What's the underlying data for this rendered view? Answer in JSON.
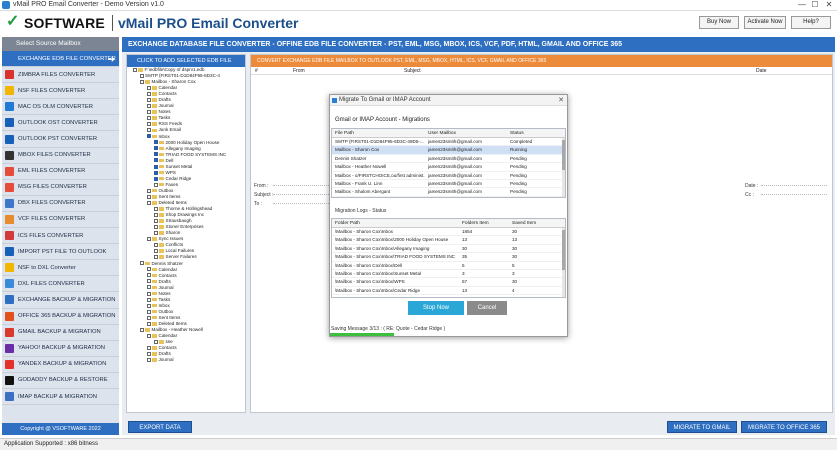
{
  "window": {
    "title": "vMail PRO Email Converter - Demo Version v1.0",
    "min": "—",
    "max": "☐",
    "close": "✕"
  },
  "header": {
    "brand": "SOFTWARE",
    "product": "vMail PRO Email Converter",
    "buy_now": "Buy Now",
    "activate_now": "Activate Now",
    "help": "Help?"
  },
  "sidebar": {
    "header": "Select Source Mailbox",
    "items": [
      {
        "label": "EXCHANGE EDB FILE CONVERTER",
        "active": true,
        "color": "#2e6fc1"
      },
      {
        "label": "ZIMBRA FILES CONVERTER",
        "active": false,
        "color": "#d9342b"
      },
      {
        "label": "NSF FILES CONVERTER",
        "active": false,
        "color": "#f2b500"
      },
      {
        "label": "MAC OS OLM CONVERTER",
        "active": false,
        "color": "#1f7bd6"
      },
      {
        "label": "OUTLOOK OST CONVERTER",
        "active": false,
        "color": "#1760b8"
      },
      {
        "label": "OUTLOOK PST CONVERTER",
        "active": false,
        "color": "#1760b8"
      },
      {
        "label": "MBOX FILES CONVERTER",
        "active": false,
        "color": "#333333"
      },
      {
        "label": "EML FILES CONVERTER",
        "active": false,
        "color": "#e44d3a"
      },
      {
        "label": "MSG FILES CONVERTER",
        "active": false,
        "color": "#e44d3a"
      },
      {
        "label": "DBX FILES CONVERTER",
        "active": false,
        "color": "#3c77c9"
      },
      {
        "label": "VCF FILES CONVERTER",
        "active": false,
        "color": "#e88b2e"
      },
      {
        "label": "ICS FILES CONVERTER",
        "active": false,
        "color": "#d23b3b"
      },
      {
        "label": "IMPORT PST FILE TO OUTLOOK",
        "active": false,
        "color": "#1760b8"
      },
      {
        "label": "NSF to DXL Converter",
        "active": false,
        "color": "#f2b500"
      },
      {
        "label": "DXL FILES CONVERTER",
        "active": false,
        "color": "#3b8bd8"
      },
      {
        "label": "EXCHANGE BACKUP & MIGRATION",
        "active": false,
        "color": "#2e6fc1"
      },
      {
        "label": "OFFICE 365 BACKUP & MIGRATION",
        "active": false,
        "color": "#e3501f"
      },
      {
        "label": "GMAIL BACKUP & MIGRATION",
        "active": false,
        "color": "#d93a2b"
      },
      {
        "label": "YAHOO! BACKUP & MIGRATION",
        "active": false,
        "color": "#6b2ca8"
      },
      {
        "label": "YANDEX BACKUP & MIGRATION",
        "active": false,
        "color": "#e4312b"
      },
      {
        "label": "GODADDY BACKUP & RESTORE",
        "active": false,
        "color": "#111111"
      },
      {
        "label": "IMAP BACKUP & MIGRATION",
        "active": false,
        "color": "#3a6fc4"
      }
    ],
    "copyright": "Copyright @ VSOFTWARE 2022"
  },
  "main": {
    "title": "EXCHANGE DATABASE FILE CONVERTER - OFFINE EDB FILE CONVERTER - PST, EML, MSG, MBOX, ICS, VCF, PDF, HTML, GMAIL AND OFFICE 365",
    "add_button": "CLICK TO ADD SELECTED EDB FILE",
    "orange_bar": "CONVERT EXCHANGE EDB FILE MAILBOX TO OUTLOOK PST, EML, MSG, MBOX, HTML, ICS, VCF, GMAIL AND OFFICE 365",
    "columns": [
      "#",
      "From",
      "Subject",
      "Date"
    ],
    "preview": {
      "from": "From :",
      "subject": "Subject :",
      "to": "To :",
      "date": "Date :",
      "cc": "Cc :"
    },
    "export_data": "EXPORT DATA",
    "migrate_gmail": "MIGRATE TO GMAIL",
    "migrate_office": "MIGRATE TO OFFICE 365"
  },
  "tree": [
    {
      "indent": 0,
      "label": "F:\\edbfile\\Copy of dsprv1.edb",
      "cb": false,
      "folder": true
    },
    {
      "indent": 1,
      "label": "SMTP (FIRST01-D1D84F95-6D3C-4",
      "cb": false,
      "folder": false
    },
    {
      "indent": 1,
      "label": "Mailbox - Sharon Cox",
      "cb": false,
      "folder": true
    },
    {
      "indent": 2,
      "label": "Calendar",
      "cb": false,
      "folder": true
    },
    {
      "indent": 2,
      "label": "Contacts",
      "cb": false,
      "folder": true
    },
    {
      "indent": 2,
      "label": "Drafts",
      "cb": false,
      "folder": true
    },
    {
      "indent": 2,
      "label": "Journal",
      "cb": false,
      "folder": true
    },
    {
      "indent": 2,
      "label": "Notes",
      "cb": false,
      "folder": true
    },
    {
      "indent": 2,
      "label": "Tasks",
      "cb": false,
      "folder": true
    },
    {
      "indent": 2,
      "label": "RSS Feeds",
      "cb": false,
      "folder": true
    },
    {
      "indent": 2,
      "label": "Junk Email",
      "cb": false,
      "folder": true
    },
    {
      "indent": 2,
      "label": "Inbox",
      "cb": true,
      "folder": true
    },
    {
      "indent": 3,
      "label": "2000 Holiday Open House",
      "cb": true,
      "folder": true
    },
    {
      "indent": 3,
      "label": "Allegany Imaging",
      "cb": true,
      "folder": true
    },
    {
      "indent": 3,
      "label": "TRIAD FOOD SYSTEMS INC",
      "cb": true,
      "folder": true
    },
    {
      "indent": 3,
      "label": "Dell",
      "cb": true,
      "folder": true
    },
    {
      "indent": 3,
      "label": "Sunset Metal",
      "cb": true,
      "folder": true
    },
    {
      "indent": 3,
      "label": "WPS",
      "cb": true,
      "folder": true
    },
    {
      "indent": 3,
      "label": "Cedar Ridge",
      "cb": true,
      "folder": true
    },
    {
      "indent": 3,
      "label": "Faxes",
      "cb": false,
      "folder": true
    },
    {
      "indent": 2,
      "label": "Outbox",
      "cb": false,
      "folder": true
    },
    {
      "indent": 2,
      "label": "Sent Items",
      "cb": false,
      "folder": true
    },
    {
      "indent": 2,
      "label": "Deleted Items",
      "cb": false,
      "folder": true
    },
    {
      "indent": 3,
      "label": "Thorne & Hollingshead",
      "cb": false,
      "folder": true
    },
    {
      "indent": 3,
      "label": "Shop Drawings Inc",
      "cb": false,
      "folder": true
    },
    {
      "indent": 3,
      "label": "Strausbaugh",
      "cb": false,
      "folder": true
    },
    {
      "indent": 3,
      "label": "Stoner Enterprises",
      "cb": false,
      "folder": true
    },
    {
      "indent": 3,
      "label": "Sharon",
      "cb": false,
      "folder": true
    },
    {
      "indent": 2,
      "label": "Sync Issues",
      "cb": false,
      "folder": true
    },
    {
      "indent": 3,
      "label": "Conflicts",
      "cb": false,
      "folder": true
    },
    {
      "indent": 3,
      "label": "Local Failures",
      "cb": false,
      "folder": true
    },
    {
      "indent": 3,
      "label": "Server Failures",
      "cb": false,
      "folder": true
    },
    {
      "indent": 1,
      "label": "Dennis Shatzer",
      "cb": false,
      "folder": true
    },
    {
      "indent": 2,
      "label": "Calendar",
      "cb": false,
      "folder": true
    },
    {
      "indent": 2,
      "label": "Contacts",
      "cb": false,
      "folder": true
    },
    {
      "indent": 2,
      "label": "Drafts",
      "cb": false,
      "folder": true
    },
    {
      "indent": 2,
      "label": "Journal",
      "cb": false,
      "folder": true
    },
    {
      "indent": 2,
      "label": "Notes",
      "cb": false,
      "folder": true
    },
    {
      "indent": 2,
      "label": "Tasks",
      "cb": false,
      "folder": true
    },
    {
      "indent": 2,
      "label": "Inbox",
      "cb": false,
      "folder": true
    },
    {
      "indent": 2,
      "label": "Outbox",
      "cb": false,
      "folder": true
    },
    {
      "indent": 2,
      "label": "Sent Items",
      "cb": false,
      "folder": true
    },
    {
      "indent": 2,
      "label": "Deleted Items",
      "cb": false,
      "folder": true
    },
    {
      "indent": 1,
      "label": "Mailbox - Heather Nowell",
      "cb": false,
      "folder": true
    },
    {
      "indent": 2,
      "label": "Calendar",
      "cb": false,
      "folder": true
    },
    {
      "indent": 3,
      "label": "sse",
      "cb": false,
      "folder": true
    },
    {
      "indent": 2,
      "label": "Contacts",
      "cb": false,
      "folder": true
    },
    {
      "indent": 2,
      "label": "Drafts",
      "cb": false,
      "folder": true
    },
    {
      "indent": 2,
      "label": "Journal",
      "cb": false,
      "folder": true
    }
  ],
  "dialog": {
    "title": "Migrate To Gmail or IMAP Account",
    "close": "✕",
    "heading": "Gmail or IMAP Account - Migrations",
    "mig_columns": [
      "File Path",
      "User Mailbox",
      "Status"
    ],
    "migrations": [
      [
        "SMTP (FIRST01-D1D84F95-6D3C-49D5-...",
        "james23smith@gmail.com",
        "Completed"
      ],
      [
        "Mailbox - Sharon Cox",
        "james23smith@gmail.com",
        "Running"
      ],
      [
        "Dennis Shatzer",
        "james23smith@gmail.com",
        "Pending"
      ],
      [
        "Mailbox - Heather Nowell",
        "james23smith@gmail.com",
        "Pending"
      ],
      [
        "Mailbox - o/FIRSTCHOICE,ou/first administ...",
        "james23smith@gmail.com",
        "Pending"
      ],
      [
        "Mailbox - Frank U. Linn",
        "james23smith@gmail.com",
        "Pending"
      ],
      [
        "Mailbox - Shalom Abergant",
        "james23smith@gmail.com",
        "Pending"
      ]
    ],
    "logs_label": "Migration Logs - Status",
    "log_columns": [
      "Folder Path",
      "Folders Item",
      "Saved Item"
    ],
    "logs": [
      [
        "\\Mailbox - Sharon Cox\\Inbox",
        "1854",
        "30"
      ],
      [
        "\\Mailbox - Sharon Cox\\Inbox\\2000 Holiday Open House",
        "13",
        "13"
      ],
      [
        "\\Mailbox - Sharon Cox\\Inbox\\Allegany Imaging",
        "30",
        "30"
      ],
      [
        "\\Mailbox - Sharon Cox\\Inbox\\TRIAD FOOD SYSTEMS INC",
        "35",
        "30"
      ],
      [
        "\\Mailbox - Sharon Cox\\Inbox\\Dell",
        "5",
        "5"
      ],
      [
        "\\Mailbox - Sharon Cox\\Inbox\\Sunset Metal",
        "3",
        "3"
      ],
      [
        "\\Mailbox - Sharon Cox\\Inbox\\WPS",
        "57",
        "30"
      ],
      [
        "\\Mailbox - Sharon Cox\\Inbox\\Cedar Ridge",
        "13",
        "4"
      ]
    ],
    "stop_now": "Stop Now",
    "cancel": "Cancel",
    "status": "Saving Message 3/13 : ( RE: Quote - Cedar Ridge )",
    "progress": 0.27
  },
  "status_bar": "Application Supported : x86 bitness"
}
